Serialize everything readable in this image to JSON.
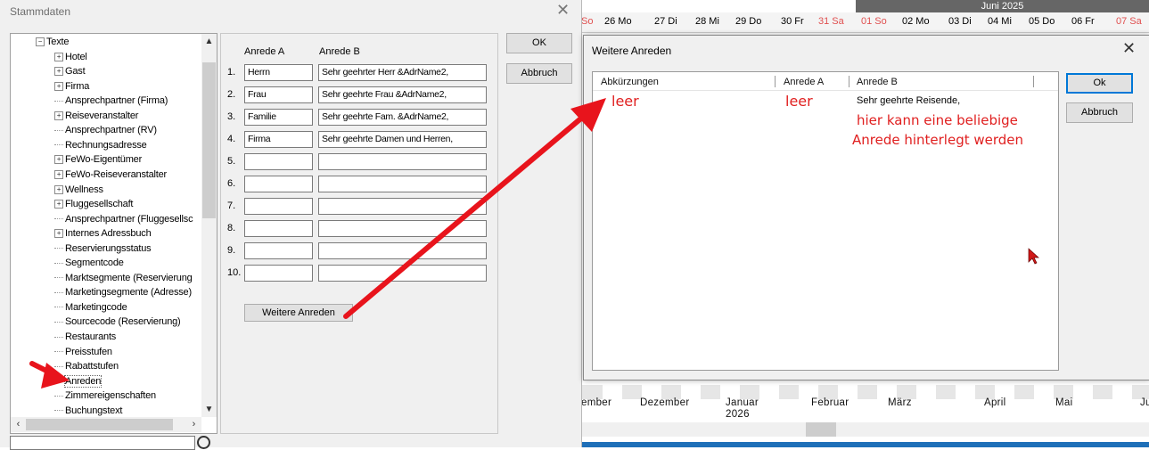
{
  "stammdaten": {
    "title": "Stammdaten",
    "close_glyph": "✕",
    "tree_items": [
      {
        "label": "Texte",
        "expander": "−"
      },
      {
        "label": "Hotel",
        "expander": "+"
      },
      {
        "label": "Gast",
        "expander": "+"
      },
      {
        "label": "Firma",
        "expander": "+"
      },
      {
        "label": "Ansprechpartner (Firma)",
        "expander": ""
      },
      {
        "label": "Reiseveranstalter",
        "expander": "+"
      },
      {
        "label": "Ansprechpartner (RV)",
        "expander": ""
      },
      {
        "label": "Rechnungsadresse",
        "expander": ""
      },
      {
        "label": "FeWo-Eigentümer",
        "expander": "+"
      },
      {
        "label": "FeWo-Reiseveranstalter",
        "expander": "+"
      },
      {
        "label": "Wellness",
        "expander": "+"
      },
      {
        "label": "Fluggesellschaft",
        "expander": "+"
      },
      {
        "label": "Ansprechpartner (Fluggesellsc",
        "expander": ""
      },
      {
        "label": "Internes Adressbuch",
        "expander": "+"
      },
      {
        "label": "Reservierungsstatus",
        "expander": ""
      },
      {
        "label": "Segmentcode",
        "expander": ""
      },
      {
        "label": "Marktsegmente (Reservierung",
        "expander": ""
      },
      {
        "label": "Marketingsegmente (Adresse)",
        "expander": ""
      },
      {
        "label": "Marketingcode",
        "expander": ""
      },
      {
        "label": "Sourcecode (Reservierung)",
        "expander": ""
      },
      {
        "label": "Restaurants",
        "expander": ""
      },
      {
        "label": "Preisstufen",
        "expander": ""
      },
      {
        "label": "Rabattstufen",
        "expander": ""
      },
      {
        "label": "Anreden",
        "expander": "",
        "selected": true
      },
      {
        "label": "Zimmereigenschaften",
        "expander": ""
      },
      {
        "label": "Buchungstext",
        "expander": ""
      }
    ],
    "col_a": "Anrede A",
    "col_b": "Anrede B",
    "rows": [
      {
        "num": "1.",
        "a": "Herrn",
        "b": "Sehr geehrter Herr &AdrName2,"
      },
      {
        "num": "2.",
        "a": "Frau",
        "b": "Sehr geehrte Frau &AdrName2,"
      },
      {
        "num": "3.",
        "a": "Familie",
        "b": "Sehr geehrte Fam. &AdrName2,"
      },
      {
        "num": "4.",
        "a": "Firma",
        "b": "Sehr geehrte Damen und Herren,"
      },
      {
        "num": "5.",
        "a": "",
        "b": ""
      },
      {
        "num": "6.",
        "a": "",
        "b": ""
      },
      {
        "num": "7.",
        "a": "",
        "b": ""
      },
      {
        "num": "8.",
        "a": "",
        "b": ""
      },
      {
        "num": "9.",
        "a": "",
        "b": ""
      },
      {
        "num": "10.",
        "a": "",
        "b": ""
      }
    ],
    "weitere_button": "Weitere Anreden",
    "ok_button": "OK",
    "cancel_button": "Abbruch"
  },
  "calendar": {
    "month_header": "Juni 2025",
    "days": [
      {
        "label": "So",
        "red": true
      },
      {
        "label": "26 Mo",
        "red": false
      },
      {
        "label": "27 Di",
        "red": false
      },
      {
        "label": "28 Mi",
        "red": false
      },
      {
        "label": "29 Do",
        "red": false
      },
      {
        "label": "30 Fr",
        "red": false
      },
      {
        "label": "31 Sa",
        "red": true
      },
      {
        "label": "01 So",
        "red": true
      },
      {
        "label": "02 Mo",
        "red": false
      },
      {
        "label": "03 Di",
        "red": false
      },
      {
        "label": "04 Mi",
        "red": false
      },
      {
        "label": "05 Do",
        "red": false
      },
      {
        "label": "06 Fr",
        "red": false
      },
      {
        "label": "07 Sa",
        "red": true
      }
    ],
    "months": [
      {
        "label": "ember"
      },
      {
        "label": "Dezember"
      },
      {
        "label": "Januar",
        "sub": "2026"
      },
      {
        "label": "Februar"
      },
      {
        "label": "März"
      },
      {
        "label": "April"
      },
      {
        "label": "Mai"
      },
      {
        "label": "Ju"
      }
    ]
  },
  "dialog": {
    "title": "Weitere Anreden",
    "close_glyph": "✕",
    "col_abk": "Abkürzungen",
    "col_a": "Anrede A",
    "col_b": "Anrede B",
    "row": {
      "abk": "leer",
      "a": "leer",
      "b": "Sehr geehrte Reisende,"
    },
    "note_line1": "hier kann eine beliebige",
    "note_line2": "Anrede hinterlegt werden",
    "ok_button": "Ok",
    "cancel_button": "Abbruch"
  },
  "colors": {
    "annotation_red": "#e02020",
    "accent_blue": "#0078d7"
  }
}
